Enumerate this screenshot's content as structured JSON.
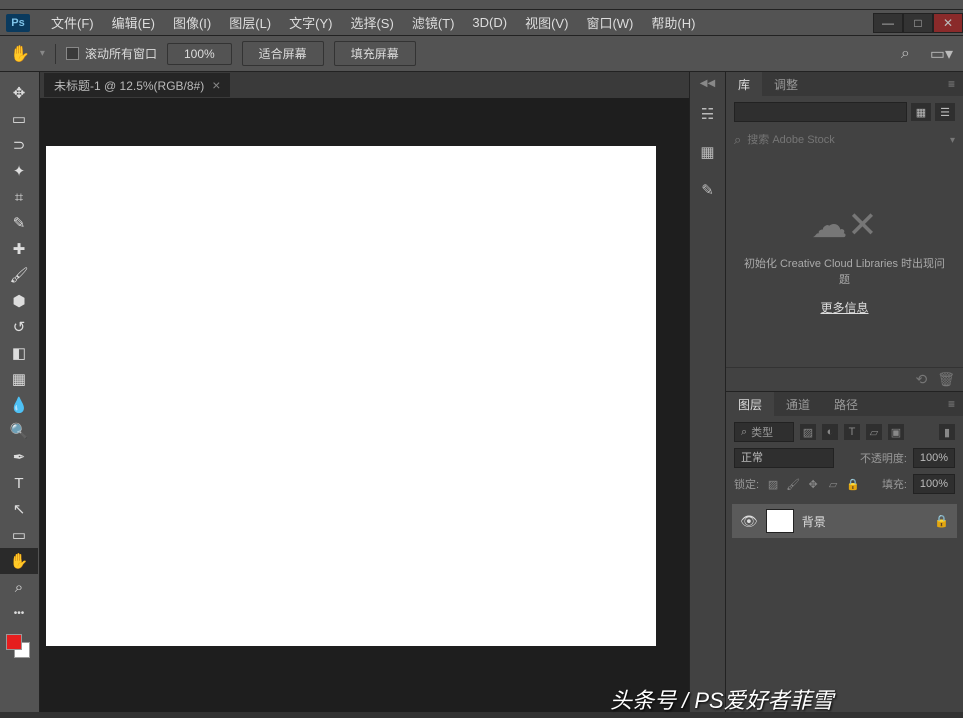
{
  "app": {
    "logo": "Ps"
  },
  "menu": {
    "file": "文件(F)",
    "edit": "编辑(E)",
    "image": "图像(I)",
    "layer": "图层(L)",
    "type": "文字(Y)",
    "select": "选择(S)",
    "filter": "滤镜(T)",
    "threed": "3D(D)",
    "view": "视图(V)",
    "window": "窗口(W)",
    "help": "帮助(H)"
  },
  "options": {
    "scroll_all": "滚动所有窗口",
    "zoom": "100%",
    "fit_screen": "适合屏幕",
    "fill_screen": "填充屏幕"
  },
  "document": {
    "tab_title": "未标题-1 @ 12.5%(RGB/8#)"
  },
  "libraries": {
    "tab_lib": "库",
    "tab_adjust": "调整",
    "search_placeholder": "搜索 Adobe Stock",
    "error_msg": "初始化 Creative Cloud Libraries 时出现问题",
    "more_info": "更多信息"
  },
  "layers_panel": {
    "tab_layers": "图层",
    "tab_channels": "通道",
    "tab_paths": "路径",
    "filter_label": "类型",
    "blend_mode": "正常",
    "opacity_label": "不透明度:",
    "opacity_value": "100%",
    "lock_label": "锁定:",
    "fill_label": "填充:",
    "fill_value": "100%",
    "layer_name": "背景"
  },
  "watermark": "头条号 / PS爱好者菲雪"
}
